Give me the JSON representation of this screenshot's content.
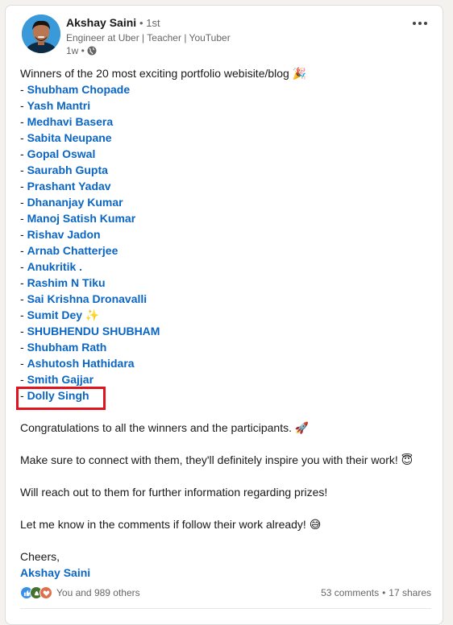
{
  "author": {
    "name": "Akshay Saini",
    "degree": "• 1st",
    "headline": "Engineer at Uber | Teacher | YouTuber",
    "time": "1w •"
  },
  "post": {
    "intro": "Winners of the 20 most exciting portfolio webisite/blog 🎉",
    "winners": [
      "Shubham Chopade",
      "Yash Mantri",
      "Medhavi Basera",
      "Sabita Neupane",
      "Gopal Oswal",
      "Saurabh Gupta",
      "Prashant Yadav",
      "Dhananjay Kumar",
      "Manoj Satish Kumar",
      "Rishav Jadon",
      "Arnab Chatterjee",
      "Anukritik .",
      "Rashim N Tiku",
      "Sai Krishna Dronavalli",
      "Sumit Dey",
      "SHUBHENDU SHUBHAM",
      "Shubham Rath",
      "Ashutosh Hathidara",
      "Smith Gajjar",
      "Dolly Singh"
    ],
    "sparkle": "✨",
    "congrats": "Congratulations to all the winners and the participants. 🚀",
    "connect": "Make sure to connect with them, they'll definitely inspire you with their work! 😇",
    "prizes": "Will reach out to them for further information regarding prizes!",
    "comments_prompt": "Let me know in the comments if follow their work already! 😅",
    "signoff": "Cheers,",
    "signature": "Akshay Saini"
  },
  "footer": {
    "reactions_text": "You and 989 others",
    "comments": "53 comments",
    "separator": "•",
    "shares": "17 shares"
  }
}
